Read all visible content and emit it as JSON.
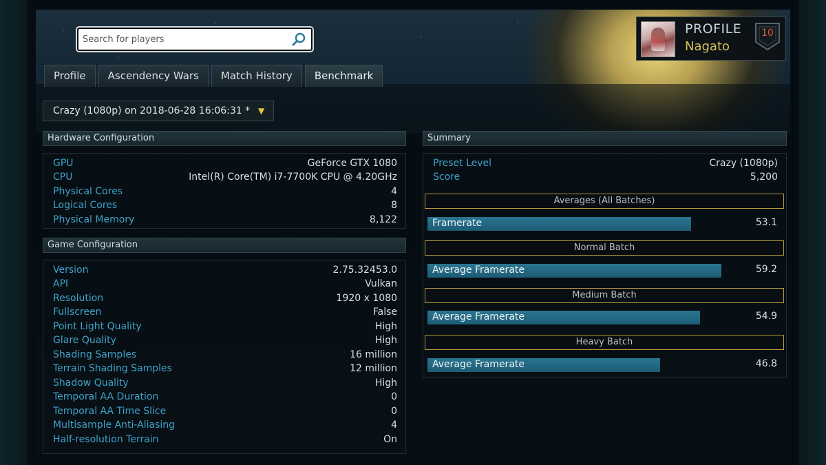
{
  "search": {
    "placeholder": "Search for players"
  },
  "profile": {
    "label": "PROFILE",
    "username": "Nagato",
    "rank": "10"
  },
  "tabs": [
    {
      "label": "Profile"
    },
    {
      "label": "Ascendency Wars"
    },
    {
      "label": "Match History"
    },
    {
      "label": "Benchmark"
    }
  ],
  "run_select": {
    "value": "Crazy (1080p) on 2018-06-28 16:06:31 *"
  },
  "hardware": {
    "title": "Hardware Configuration",
    "rows": [
      {
        "key": "GPU",
        "value": "GeForce GTX 1080"
      },
      {
        "key": "CPU",
        "value": "Intel(R) Core(TM) i7-7700K CPU @ 4.20GHz"
      },
      {
        "key": "Physical Cores",
        "value": "4"
      },
      {
        "key": "Logical Cores",
        "value": "8"
      },
      {
        "key": "Physical Memory",
        "value": "8,122"
      }
    ]
  },
  "game": {
    "title": "Game Configuration",
    "rows": [
      {
        "key": "Version",
        "value": "2.75.32453.0"
      },
      {
        "key": "API",
        "value": "Vulkan"
      },
      {
        "key": "Resolution",
        "value": "1920 x 1080"
      },
      {
        "key": "Fullscreen",
        "value": "False"
      },
      {
        "key": "Point Light Quality",
        "value": "High"
      },
      {
        "key": "Glare Quality",
        "value": "High"
      },
      {
        "key": "Shading Samples",
        "value": "16 million"
      },
      {
        "key": "Terrain Shading Samples",
        "value": "12 million"
      },
      {
        "key": "Shadow Quality",
        "value": "High"
      },
      {
        "key": "Temporal AA Duration",
        "value": "0"
      },
      {
        "key": "Temporal AA Time Slice",
        "value": "0"
      },
      {
        "key": "Multisample Anti-Aliasing",
        "value": "4"
      },
      {
        "key": "Half-resolution Terrain",
        "value": "On"
      }
    ]
  },
  "summary": {
    "title": "Summary",
    "rows": [
      {
        "key": "Preset Level",
        "value": "Crazy (1080p)"
      },
      {
        "key": "Score",
        "value": "5,200"
      }
    ],
    "sections": [
      {
        "heading": "Averages (All Batches)",
        "bar_label": "Framerate",
        "value": "53.1",
        "fraction": 0.708
      },
      {
        "heading": "Normal Batch",
        "bar_label": "Average Framerate",
        "value": "59.2",
        "fraction": 0.789
      },
      {
        "heading": "Medium Batch",
        "bar_label": "Average Framerate",
        "value": "54.9",
        "fraction": 0.732
      },
      {
        "heading": "Heavy Batch",
        "bar_label": "Average Framerate",
        "value": "46.8",
        "fraction": 0.624
      }
    ]
  },
  "colors": {
    "accent_key": "#3fa3c7",
    "bar_fill": "#1f6580",
    "section_border": "#b99f3e",
    "profile_name": "#d9c25a"
  }
}
